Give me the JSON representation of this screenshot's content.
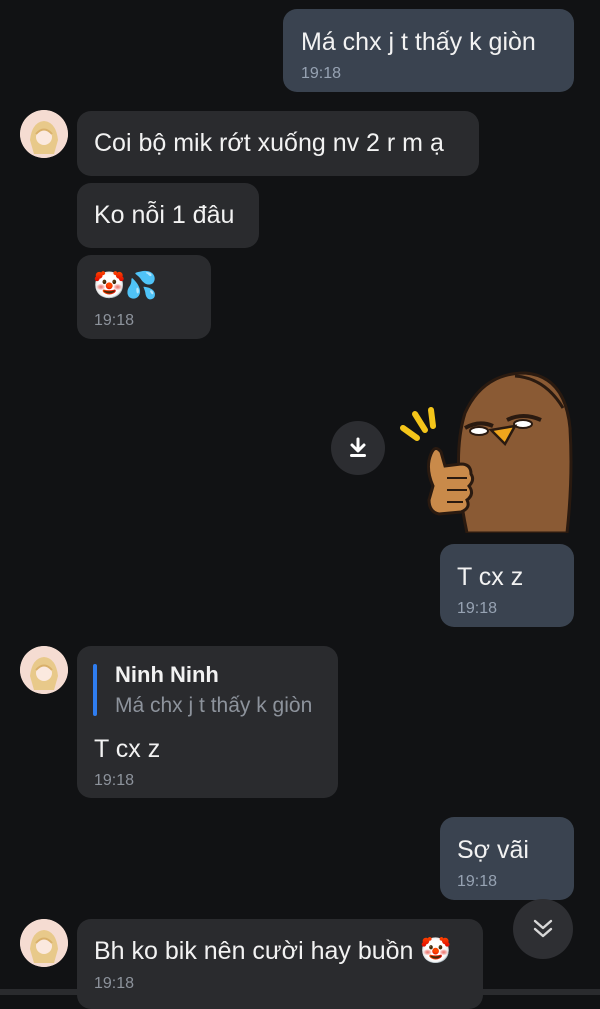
{
  "messages": {
    "m1": {
      "text": "Má chx j t thấy k giòn",
      "time": "19:18"
    },
    "m2": {
      "text": "Coi bộ mik rớt xuống nv 2 r m ạ"
    },
    "m3": {
      "text": "Ko nỗi 1 đâu"
    },
    "m4": {
      "emoji": "🤡💦",
      "time": "19:18"
    },
    "m5": {
      "sticker": "thumbs-up-bird-sticker"
    },
    "m6": {
      "text": "T cx z",
      "time": "19:18"
    },
    "m7": {
      "quote_name": "Ninh Ninh",
      "quote_text": "Má chx j t thấy k giòn",
      "text": "T cx z",
      "time": "19:18"
    },
    "m8": {
      "text": "Sợ vãi",
      "time": "19:18"
    },
    "m9": {
      "text": "Bh ko bik nên cười hay buồn 🤡",
      "time": "19:18"
    }
  },
  "icons": {
    "download": "download-icon",
    "scroll_down": "double-chevron-down-icon"
  },
  "colors": {
    "background": "#111214",
    "incoming_bubble": "#2a2b2e",
    "outgoing_bubble": "#3a4350",
    "quote_accent": "#2f7df0"
  }
}
